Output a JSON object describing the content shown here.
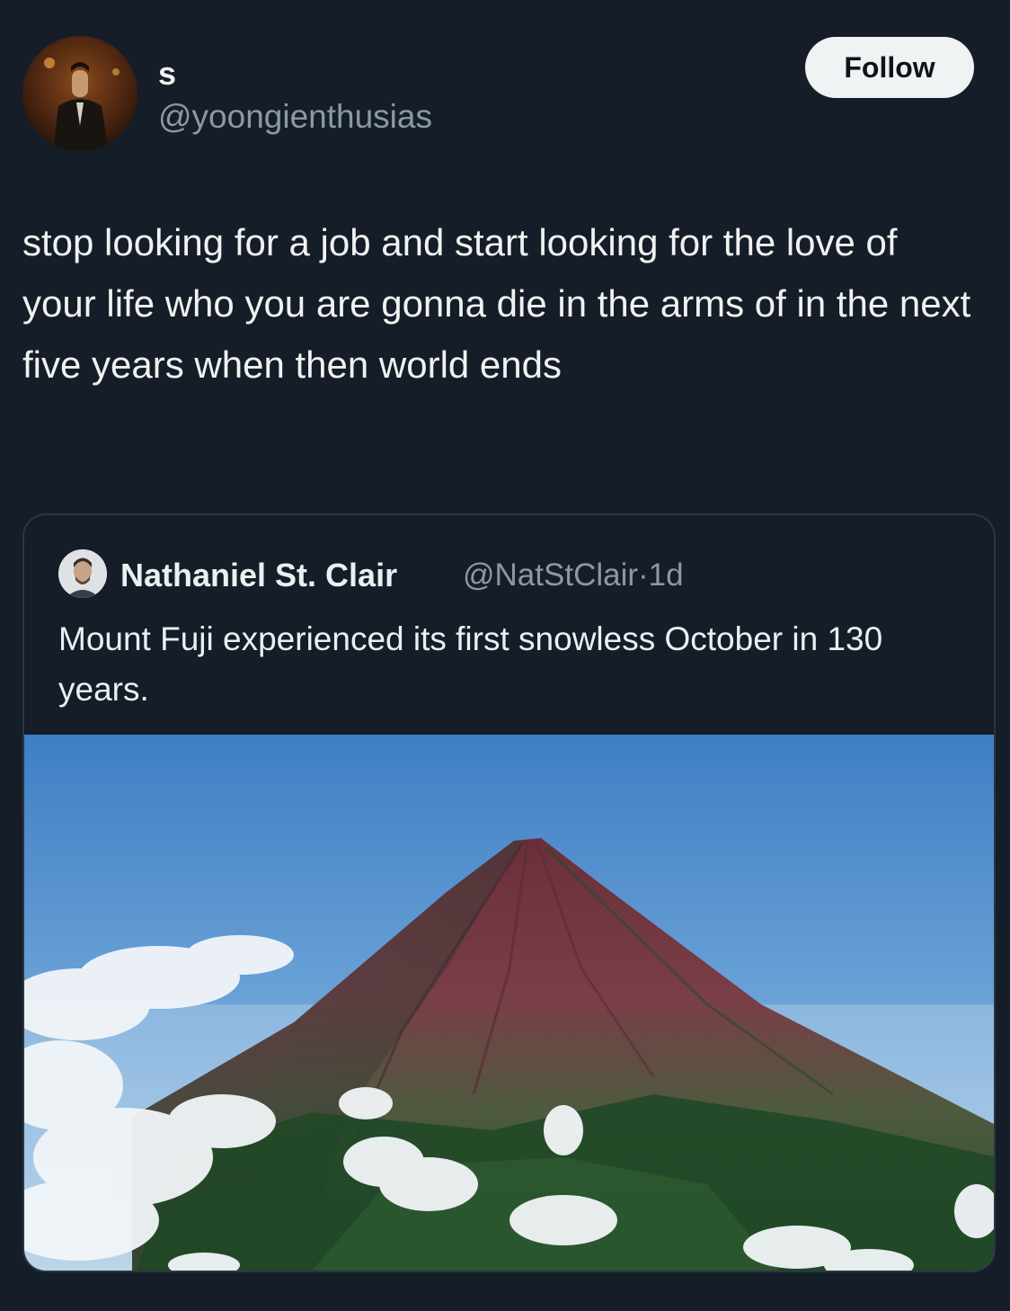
{
  "author": {
    "display_name": "s",
    "handle": "@yoongienthusias",
    "avatar_icon": "profile-photo-man-in-suit"
  },
  "follow_button": {
    "label": "Follow"
  },
  "tweet": {
    "text": "stop looking for a job and start looking for the love of your life who you are gonna die in the arms of in the next five years when then world ends"
  },
  "quoted_tweet": {
    "display_name": "Nathaniel St. Clair",
    "handle": "@NatStClair",
    "separator": "·",
    "time": "1d",
    "text": "Mount Fuji experienced its first snowless October in 130 years.",
    "avatar_icon": "profile-photo-man",
    "image_icon": "mount-fuji-photo"
  },
  "colors": {
    "background": "#151d28",
    "follow_bg": "#eff3f4",
    "secondary_text": "#8b98a5"
  }
}
